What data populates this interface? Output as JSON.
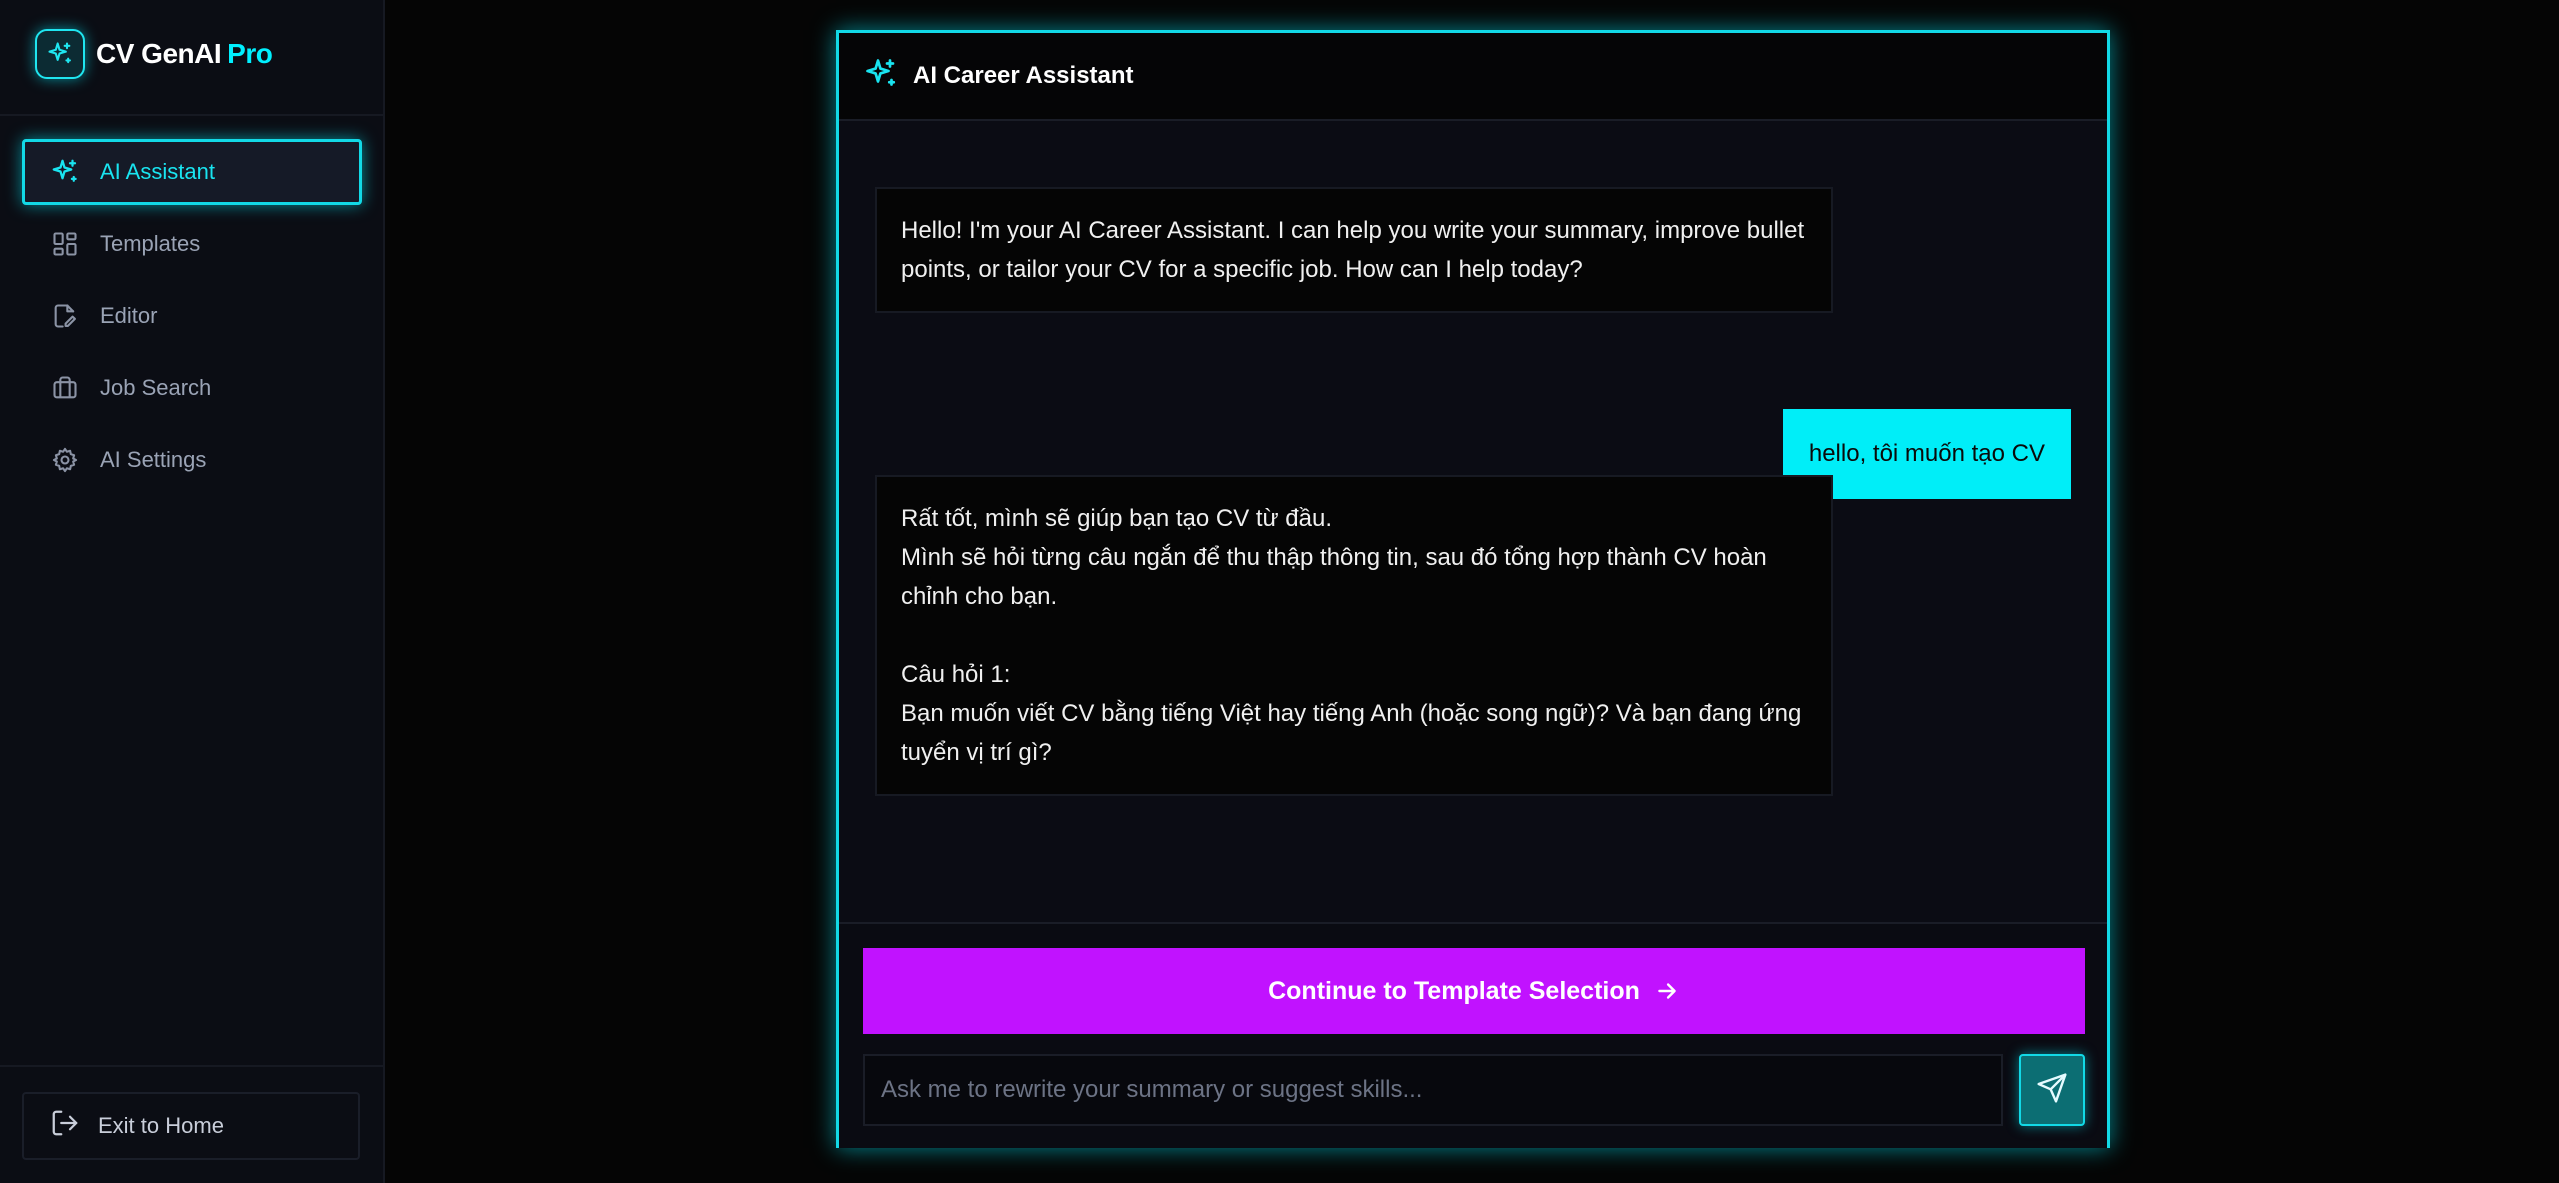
{
  "brand": {
    "name": "CV GenAI",
    "accent": "Pro",
    "icon": "sparkles-icon"
  },
  "sidebar": {
    "items": [
      {
        "label": "AI Assistant",
        "icon": "sparkles-icon",
        "active": true
      },
      {
        "label": "Templates",
        "icon": "layout-grid-icon",
        "active": false
      },
      {
        "label": "Editor",
        "icon": "file-edit-icon",
        "active": false
      },
      {
        "label": "Job Search",
        "icon": "briefcase-icon",
        "active": false
      },
      {
        "label": "AI Settings",
        "icon": "gear-icon",
        "active": false
      }
    ],
    "footer": {
      "exit_label": "Exit to Home",
      "icon": "logout-icon"
    }
  },
  "chat": {
    "title": "AI Career Assistant",
    "messages": [
      {
        "role": "assistant",
        "text": "Hello! I'm your AI Career Assistant. I can help you write your summary, improve bullet points, or tailor your CV for a specific job. How can I help today?"
      },
      {
        "role": "user",
        "text": "hello, tôi muốn tạo CV"
      },
      {
        "role": "assistant",
        "text": "Rất tốt, mình sẽ giúp bạn tạo CV từ đầu.\nMình sẽ hỏi từng câu ngắn để thu thập thông tin, sau đó tổng hợp thành CV hoàn chỉnh cho bạn.\n\nCâu hỏi 1:\nBạn muốn viết CV bằng tiếng Việt hay tiếng Anh (hoặc song ngữ)? Và bạn đang ứng tuyển vị trí gì?"
      }
    ],
    "continue_label": "Continue to Template Selection",
    "input_placeholder": "Ask me to rewrite your summary or suggest skills...",
    "input_value": ""
  },
  "colors": {
    "accent": "#00f0ff",
    "cta": "#c112ff",
    "background": "#050505",
    "sidebar": "#0b0d14"
  }
}
